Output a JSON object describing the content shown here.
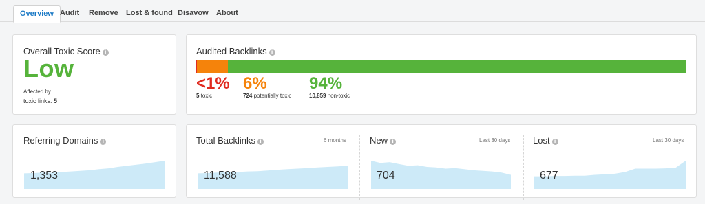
{
  "tabs": [
    {
      "label": "Overview",
      "active": true
    },
    {
      "label": "Audit",
      "active": false
    },
    {
      "label": "Remove",
      "active": false
    },
    {
      "label": "Lost & found",
      "active": false
    },
    {
      "label": "Disavow",
      "active": false
    },
    {
      "label": "About",
      "active": false
    }
  ],
  "toxic_score": {
    "title": "Overall Toxic Score",
    "value": "Low",
    "value_color": "#56b33b",
    "affected_by": "Affected by",
    "toxic_links_label": "toxic links:",
    "toxic_links_count": "5"
  },
  "audited": {
    "title": "Audited Backlinks",
    "segments": [
      {
        "key": "toxic",
        "percent_text": "<1%",
        "count": "5",
        "label": "toxic",
        "color": "#e02b20",
        "share": 0.0004
      },
      {
        "key": "potentially_toxic",
        "percent_text": "6%",
        "count": "724",
        "label": "potentially toxic",
        "color": "#f5830b",
        "share": 0.0624
      },
      {
        "key": "non_toxic",
        "percent_text": "94%",
        "count": "10,859",
        "label": "non-toxic",
        "color": "#56b33b",
        "share": 0.9372
      }
    ]
  },
  "referring_domains": {
    "title": "Referring Domains",
    "value": "1,353",
    "trend": [
      0.55,
      0.56,
      0.58,
      0.57,
      0.6,
      0.62,
      0.64,
      0.66,
      0.7,
      0.73,
      0.78,
      0.82,
      0.86,
      0.9,
      0.95,
      1.0
    ]
  },
  "total_backlinks": {
    "title": "Total Backlinks",
    "period": "6 months",
    "value": "11,588",
    "trend": [
      0.55,
      0.56,
      0.58,
      0.59,
      0.6,
      0.62,
      0.63,
      0.65,
      0.68,
      0.7,
      0.72,
      0.74,
      0.76,
      0.78,
      0.8,
      0.82
    ]
  },
  "new": {
    "title": "New",
    "period": "Last 30 days",
    "value": "704",
    "trend": [
      1.0,
      0.92,
      0.95,
      0.88,
      0.82,
      0.84,
      0.78,
      0.76,
      0.72,
      0.74,
      0.7,
      0.66,
      0.64,
      0.62,
      0.58,
      0.5
    ]
  },
  "lost": {
    "title": "Lost",
    "period": "Last 30 days",
    "value": "677",
    "trend": [
      0.45,
      0.45,
      0.46,
      0.46,
      0.47,
      0.47,
      0.5,
      0.52,
      0.54,
      0.6,
      0.72,
      0.72,
      0.72,
      0.73,
      0.75,
      1.0
    ]
  },
  "colors": {
    "accent": "#1a79c5",
    "spark_fill": "#cdeaf8"
  }
}
